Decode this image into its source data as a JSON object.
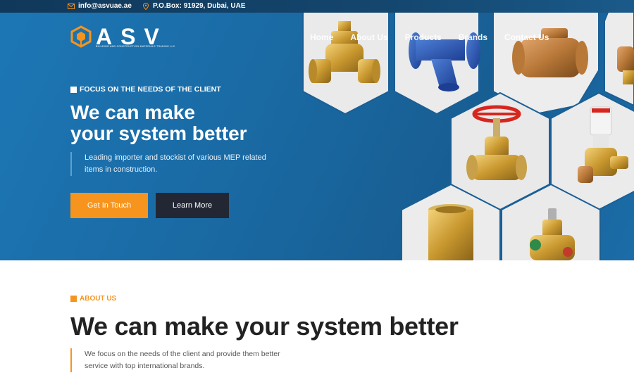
{
  "topbar": {
    "email": "info@asvuae.ae",
    "address": "P.O.Box: 91929, Dubai, UAE"
  },
  "logo": {
    "brand": "ASV",
    "tagline": "BUILDING AND CONSTRUCTION MATERIALS TRADING LLC"
  },
  "nav": {
    "items": [
      "Home",
      "About Us",
      "Products",
      "Brands",
      "Contact Us"
    ]
  },
  "hero": {
    "kicker": "FOCUS ON THE NEEDS OF THE CLIENT",
    "headline_line1": "We can make",
    "headline_line2": "your system better",
    "description": "Leading importer and stockist of various MEP related items in construction.",
    "primary_button": "Get In Touch",
    "secondary_button": "Learn More"
  },
  "about": {
    "kicker": "ABOUT US",
    "title": "We can make your system better",
    "description": "We focus on the needs of the client and provide them better service with top international brands."
  },
  "colors": {
    "accent": "#f7941d",
    "hero_blue": "#1a6aa4",
    "dark_button": "#222733"
  }
}
